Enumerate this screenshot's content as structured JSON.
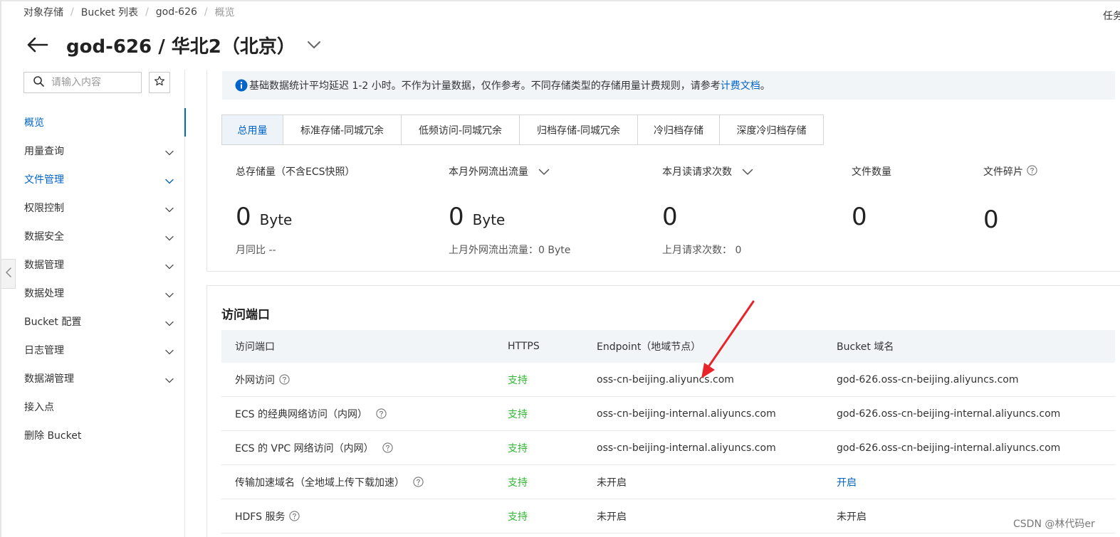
{
  "breadcrumb": [
    "对象存储",
    "Bucket 列表",
    "god-626",
    "概览"
  ],
  "top_right_text": "任务",
  "page_title": "god-626 / 华北2（北京）",
  "sidebar": {
    "search_placeholder": "请输入内容",
    "items": [
      {
        "label": "概览",
        "state": "active",
        "chevron": false
      },
      {
        "label": "用量查询",
        "state": "normal",
        "chevron": true
      },
      {
        "label": "文件管理",
        "state": "blue",
        "chevron": true
      },
      {
        "label": "权限控制",
        "state": "normal",
        "chevron": true
      },
      {
        "label": "数据安全",
        "state": "normal",
        "chevron": true
      },
      {
        "label": "数据管理",
        "state": "normal",
        "chevron": true
      },
      {
        "label": "数据处理",
        "state": "normal",
        "chevron": true
      },
      {
        "label": "Bucket 配置",
        "state": "normal",
        "chevron": true
      },
      {
        "label": "日志管理",
        "state": "normal",
        "chevron": true
      },
      {
        "label": "数据湖管理",
        "state": "normal",
        "chevron": true
      },
      {
        "label": "接入点",
        "state": "normal",
        "chevron": false
      },
      {
        "label": "删除 Bucket",
        "state": "normal",
        "chevron": false
      }
    ]
  },
  "notice": {
    "text": "基础数据统计平均延迟 1-2 小时。不作为计量数据，仅作参考。不同存储类型的存储用量计费规则，请参考",
    "link": "计费文档",
    "suffix": " 。"
  },
  "tabs": [
    {
      "label": "总用量",
      "active": true
    },
    {
      "label": "标准存储-同城冗余",
      "active": false
    },
    {
      "label": "低频访问-同城冗余",
      "active": false
    },
    {
      "label": "归档存储-同城冗余",
      "active": false
    },
    {
      "label": "冷归档存储",
      "active": false
    },
    {
      "label": "深度冷归档存储",
      "active": false
    }
  ],
  "stats": [
    {
      "label": "总存储量（不含ECS快照）",
      "value": "0",
      "unit": "Byte",
      "sub": "月同比 --"
    },
    {
      "label": "本月外网流出流量",
      "value": "0",
      "unit": "Byte",
      "sub": "上月外网流出流量：0 Byte"
    },
    {
      "label": "本月读请求次数",
      "value": "0",
      "unit": "",
      "sub": "上月请求次数：  0"
    },
    {
      "label": "文件数量",
      "value": "0",
      "unit": "",
      "sub": ""
    },
    {
      "label": "文件碎片",
      "value": "0",
      "unit": "",
      "sub": ""
    }
  ],
  "access": {
    "title": "访问端口",
    "headers": [
      "访问端口",
      "HTTPS",
      "Endpoint（地域节点）",
      "Bucket 域名"
    ],
    "rows": [
      {
        "name": "外网访问",
        "https": "支持",
        "endpoint": "oss-cn-beijing.aliyuncs.com",
        "domain": "god-626.oss-cn-beijing.aliyuncs.com"
      },
      {
        "name": "ECS 的经典网络访问（内网）",
        "https": "支持",
        "endpoint": "oss-cn-beijing-internal.aliyuncs.com",
        "domain": "god-626.oss-cn-beijing-internal.aliyuncs.com"
      },
      {
        "name": "ECS 的 VPC 网络访问（内网）",
        "https": "支持",
        "endpoint": "oss-cn-beijing-internal.aliyuncs.com",
        "domain": "god-626.oss-cn-beijing-internal.aliyuncs.com"
      },
      {
        "name": "传输加速域名（全地域上传下载加速）",
        "https": "支持",
        "endpoint": "未开启",
        "domain": "开启"
      },
      {
        "name": "HDFS 服务",
        "https": "支持",
        "endpoint": "未开启",
        "domain": "未开启"
      }
    ]
  },
  "watermark": "CSDN @林代码er",
  "colors": {
    "accent": "#0064c8",
    "support_green": "#2eb82e",
    "arrow_red": "#e8242a"
  }
}
